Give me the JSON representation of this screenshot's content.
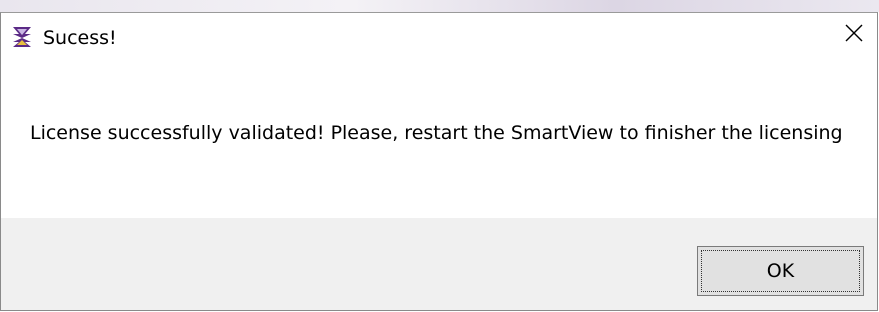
{
  "dialog": {
    "title": "Sucess!",
    "message": "License successfully validated! Please, restart the SmartView to finisher the licensing",
    "ok_label": "OK",
    "close_glyph": "✕",
    "app_icon": "smartview-logo-icon",
    "close_icon": "close-icon"
  },
  "colors": {
    "footer_background": "#f0f0f0",
    "button_background": "#e1e1e1",
    "icon_purple": "#5b2a86"
  }
}
